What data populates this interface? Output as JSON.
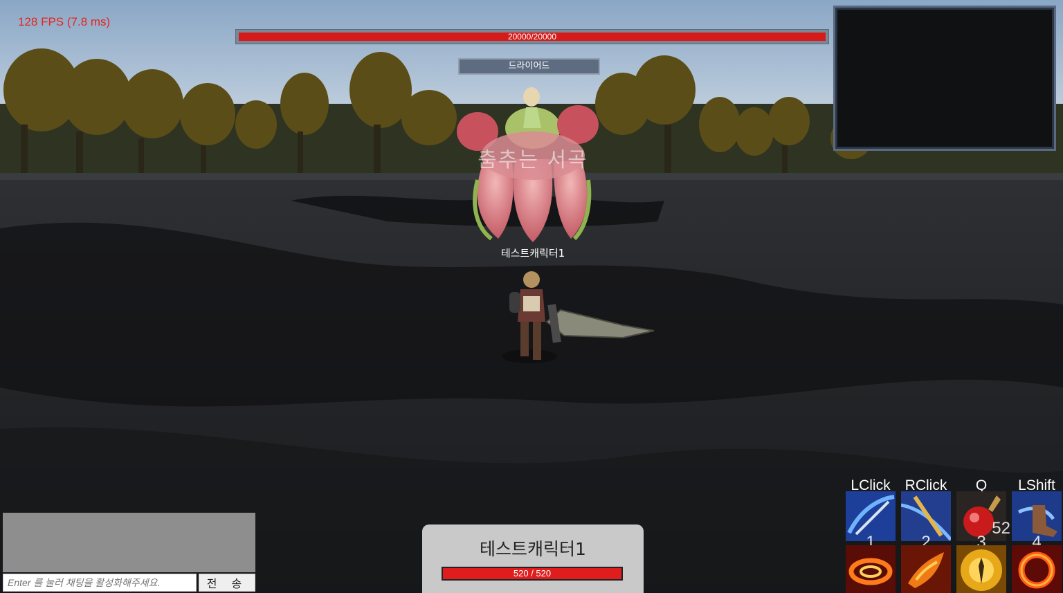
{
  "hud": {
    "fps": "128 FPS (7.8 ms)",
    "boss_hp_text": "20000/20000",
    "boss_hp_fraction": 1.0,
    "boss_name": "드라이어드",
    "zone_title": "춤추는 서곡",
    "character_label": "테스트캐릭터1"
  },
  "player": {
    "name": "테스트캐릭터1",
    "hp_text": "520 / 520",
    "hp_fraction": 1.0
  },
  "chat": {
    "placeholder": "Enter 를 눌러 채팅을 활성화해주세요.",
    "send_label": "전 송"
  },
  "skills": {
    "keys": [
      "LClick",
      "RClick",
      "Q",
      "LShift"
    ],
    "slot_numbers": [
      "1",
      "2",
      "3",
      "4"
    ],
    "potion_count": "52"
  },
  "colors": {
    "hp_red": "#e01d1d",
    "fps_red": "#e8231f",
    "boss_name_bg": "#5d6c80"
  }
}
